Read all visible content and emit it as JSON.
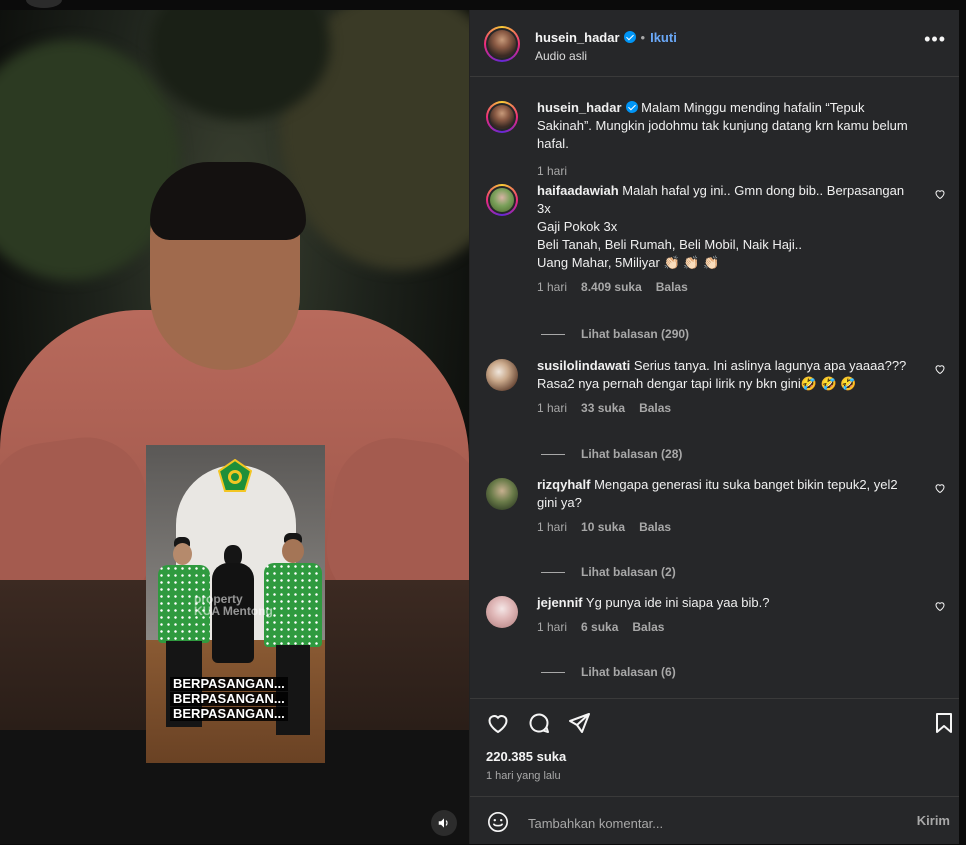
{
  "post": {
    "author": "husein_hadar",
    "follow_label": "Ikuti",
    "audio": "Audio asli",
    "more": "•••",
    "caption_author": "husein_hadar",
    "caption_text": "Malam Minggu mending hafalin “Tepuk Sakinah”. Mungkin jodohmu tak kunjung datang krn kamu belum hafal.",
    "caption_time": "1 hari"
  },
  "media": {
    "inner_watermark": "property\nKUA Mentong",
    "inner_caption_lines": [
      "BERPASANGAN...",
      "BERPASANGAN...",
      "BERPASANGAN..."
    ],
    "mute_icon": "speaker-icon"
  },
  "comments": [
    {
      "user": "haifaadawiah",
      "text": "Malah hafal yg ini.. Gmn dong bib.. Berpasangan 3x\nGaji Pokok 3x\nBeli Tanah, Beli Rumah, Beli Mobil, Naik Haji..\nUang Mahar, 5Miliyar 👏🏻 👏🏻 👏🏻",
      "time": "1 hari",
      "likes": "8.409 suka",
      "reply": "Balas",
      "view_replies": "Lihat balasan (290)"
    },
    {
      "user": "susilolindawati",
      "text": "Serius tanya. Ini aslinya lagunya apa yaaaa??? Rasa2 nya pernah dengar tapi lirik ny bkn gini🤣 🤣 🤣",
      "time": "1 hari",
      "likes": "33 suka",
      "reply": "Balas",
      "view_replies": "Lihat balasan (28)"
    },
    {
      "user": "rizqyhalf",
      "text": "Mengapa generasi itu suka banget bikin tepuk2, yel2 gini ya?",
      "time": "1 hari",
      "likes": "10 suka",
      "reply": "Balas",
      "view_replies": "Lihat balasan (2)"
    },
    {
      "user": "jejennif",
      "text": "Yg punya ide ini siapa yaa bib.?",
      "time": "1 hari",
      "likes": "6 suka",
      "reply": "Balas",
      "view_replies": "Lihat balasan (6)"
    }
  ],
  "footer": {
    "likes": "220.385 suka",
    "date": "1 hari yang lalu",
    "comment_placeholder": "Tambahkan komentar...",
    "post_label": "Kirim"
  },
  "colors": {
    "panel_bg": "#262729",
    "link_blue": "#6aa8f7",
    "verified_blue": "#0095f6",
    "muted_text": "#a8a8a8"
  }
}
